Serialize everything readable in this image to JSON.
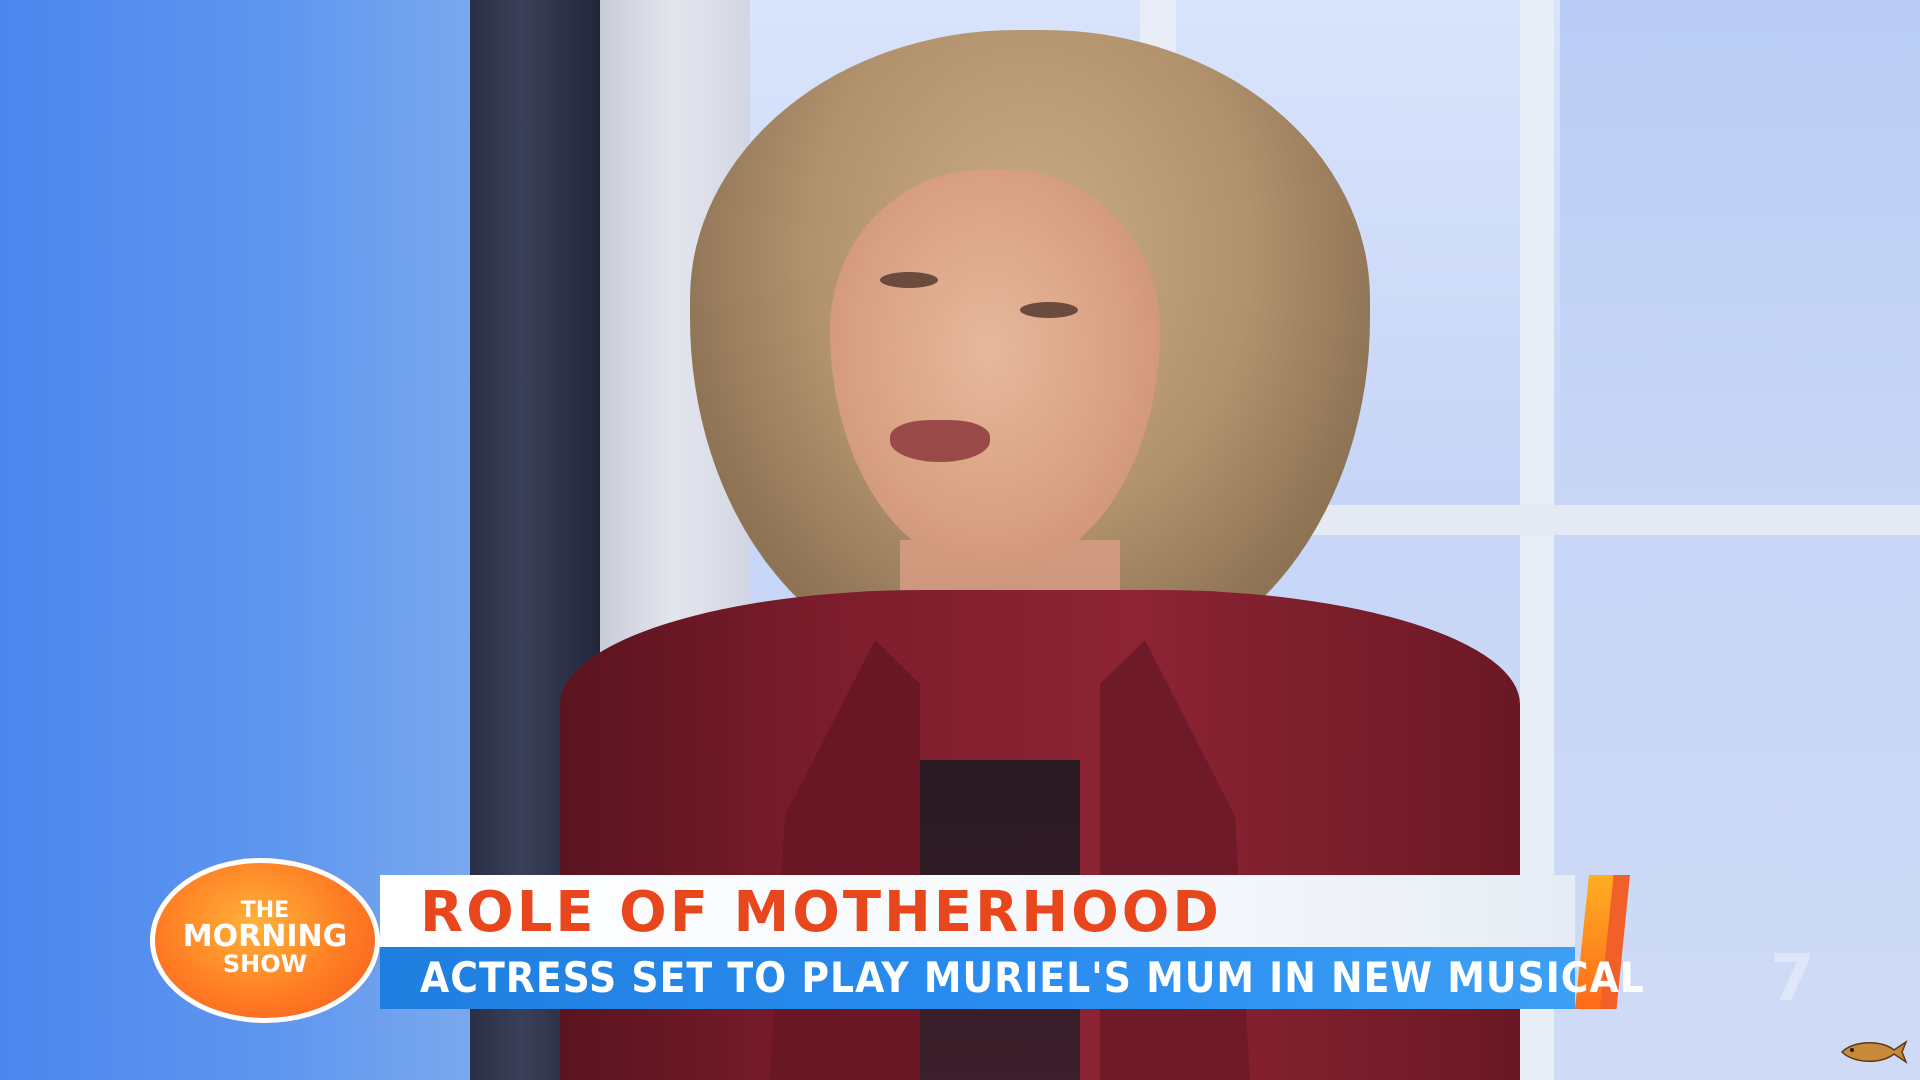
{
  "lower_third": {
    "headline": "ROLE OF MOTHERHOOD",
    "subline": "ACTRESS SET TO PLAY MURIEL'S MUM IN NEW MUSICAL"
  },
  "logo": {
    "line1": "THE",
    "line2": "MORNING",
    "line3": "SHOW"
  },
  "network_logo_icon": "channel-seven-icon",
  "watermark_icon": "fish-icon",
  "colors": {
    "headline": "#e8461c",
    "subline_bar": "#1f7fe0",
    "logo_orange": "#ff7a22",
    "jacket": "#7e1d2c"
  }
}
